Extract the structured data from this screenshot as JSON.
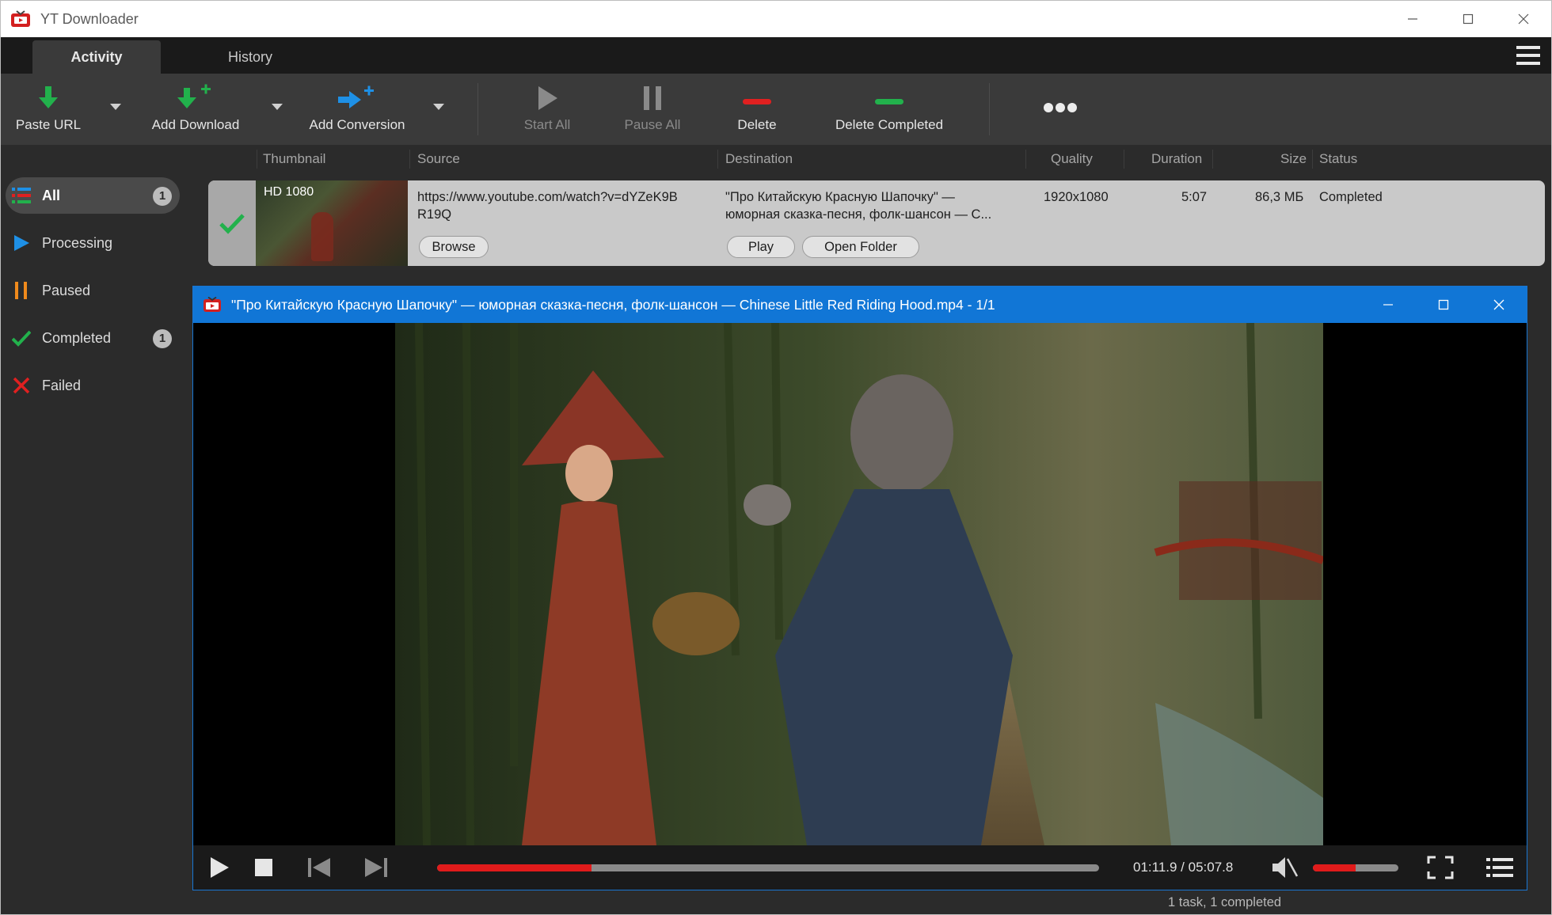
{
  "window": {
    "title": "YT Downloader"
  },
  "tabs": [
    {
      "label": "Activity",
      "active": true
    },
    {
      "label": "History",
      "active": false
    }
  ],
  "toolbar": {
    "paste_url": "Paste URL",
    "add_download": "Add Download",
    "add_conversion": "Add Conversion",
    "start_all": "Start All",
    "pause_all": "Pause All",
    "delete": "Delete",
    "delete_completed": "Delete Completed"
  },
  "columns": [
    "Thumbnail",
    "Source",
    "Destination",
    "Quality",
    "Duration",
    "Size",
    "Status"
  ],
  "sidebar": {
    "items": [
      {
        "label": "All",
        "badge": "1",
        "icon": "list-icon",
        "active": true
      },
      {
        "label": "Processing",
        "badge": "",
        "icon": "play-icon"
      },
      {
        "label": "Paused",
        "badge": "",
        "icon": "pause-icon"
      },
      {
        "label": "Completed",
        "badge": "1",
        "icon": "check-icon"
      },
      {
        "label": "Failed",
        "badge": "",
        "icon": "cross-icon"
      }
    ]
  },
  "download": {
    "thumb_label": "HD 1080",
    "source_line1": "https://www.youtube.com/watch?v=dYZeK9B",
    "source_line2": "R19Q",
    "dest_line1": "\"Про Китайскую Красную Шапочку\" —",
    "dest_line2": "юморная сказка-песня, фолк-шансон — С...",
    "quality": "1920x1080",
    "duration": "5:07",
    "size": "86,3 МБ",
    "status": "Completed",
    "browse": "Browse",
    "play": "Play",
    "open_folder": "Open Folder"
  },
  "player": {
    "title": "\"Про Китайскую Красную Шапочку\" — юморная сказка-песня, фолк-шансон — Chinese Little Red Riding Hood.mp4 - 1/1",
    "time": "01:11.9 / 05:07.8",
    "progress_fraction": 0.233,
    "volume_fraction": 0.5
  },
  "status_bar": {
    "text": "1 task, 1 completed"
  },
  "colors": {
    "accent_blue": "#1176d6",
    "progress_red": "#e01b1b",
    "ok_green": "#22b14c"
  }
}
